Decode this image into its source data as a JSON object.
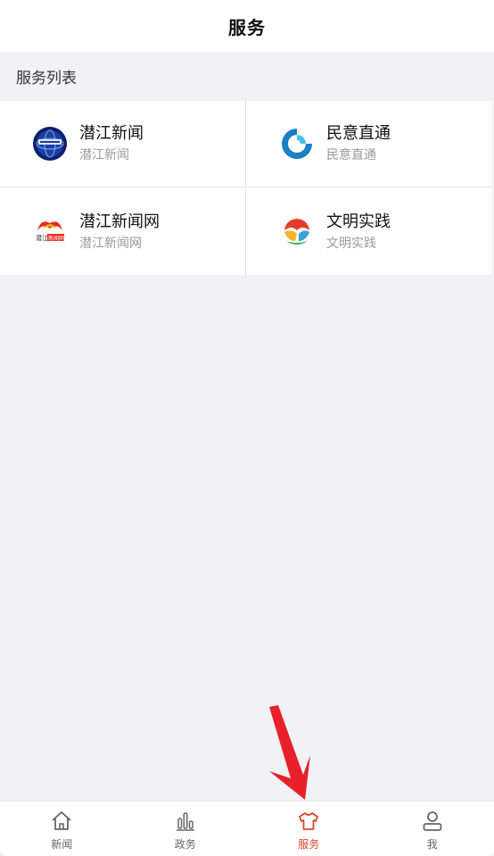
{
  "header": {
    "title": "服务"
  },
  "section": {
    "title": "服务列表"
  },
  "services": [
    {
      "name": "潜江新闻",
      "sub": "潜江新闻",
      "icon": "qianjiang-news-logo-icon"
    },
    {
      "name": "民意直通",
      "sub": "民意直通",
      "icon": "minyi-zhitong-logo-icon"
    },
    {
      "name": "潜江新闻网",
      "sub": "潜江新闻网",
      "icon": "qianjiang-news-web-logo-icon"
    },
    {
      "name": "文明实践",
      "sub": "文明实践",
      "icon": "wenming-shijian-logo-icon"
    }
  ],
  "tabs": [
    {
      "label": "新闻",
      "icon": "home-icon"
    },
    {
      "label": "政务",
      "icon": "bar-chart-icon"
    },
    {
      "label": "服务",
      "icon": "shirt-icon",
      "active": true
    },
    {
      "label": "我",
      "icon": "user-icon"
    }
  ],
  "colors": {
    "accent": "#e0432b",
    "annotation_arrow": "#e8202a"
  }
}
